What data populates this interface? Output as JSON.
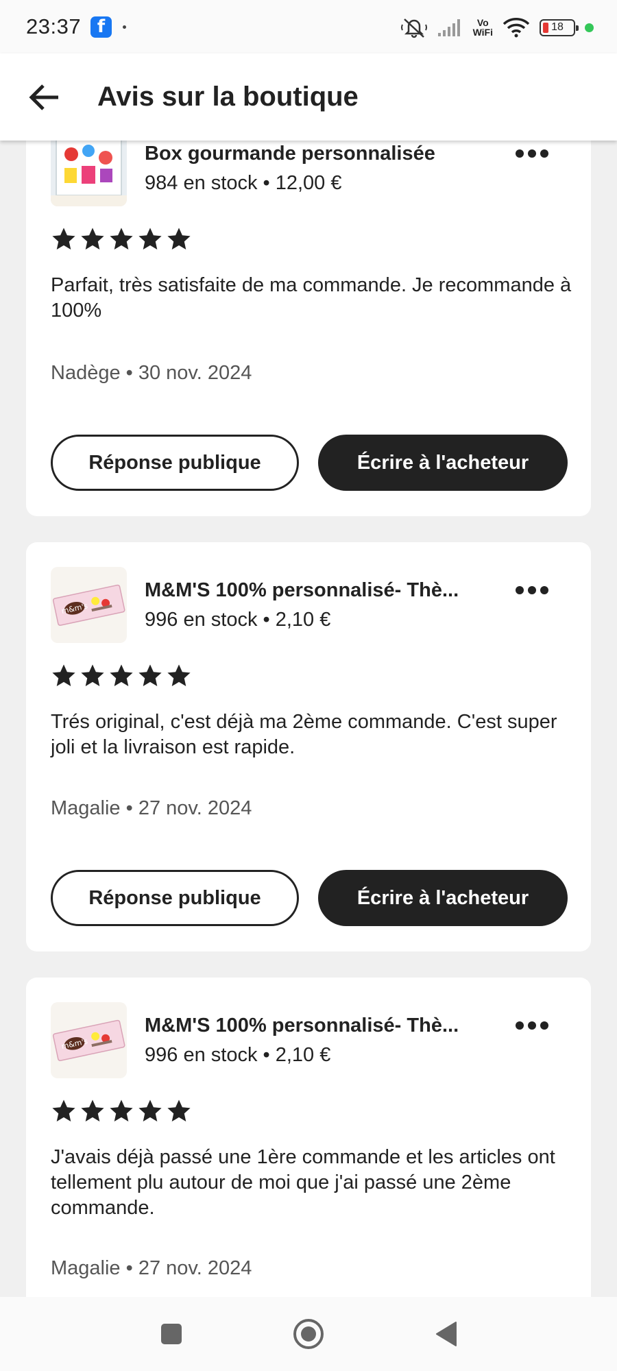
{
  "status_bar": {
    "time": "23:37",
    "battery_level": "18",
    "notification_icons": [
      "facebook-icon"
    ],
    "indicator_icons": [
      "mute-vibrate-icon",
      "signal-icon",
      "vowifi-icon",
      "wifi-icon",
      "battery-icon",
      "privacy-dot-icon"
    ],
    "vowifi_top": "Vo",
    "vowifi_bottom": "WiFi"
  },
  "header": {
    "back_icon": "arrow-left-icon",
    "title": "Avis sur la boutique"
  },
  "reviews": [
    {
      "product_title": "Box gourmande personnalisée",
      "product_meta": "984 en stock • 12,00 €",
      "rating": 5,
      "text": "Parfait, très satisfaite de ma commande. Je recommande à 100%",
      "reviewer": "Nadège • 30 nov. 2024",
      "public_reply_label": "Réponse publique",
      "message_buyer_label": "Écrire à l'acheteur",
      "thumbnail": "box-gift-image"
    },
    {
      "product_title": "M&M'S 100% personnalisé- Thè...",
      "product_meta": "996 en stock • 2,10 €",
      "rating": 5,
      "text": "Trés original, c'est déjà ma 2ème commande. C'est super joli et la livraison est rapide.",
      "reviewer": "Magalie • 27 nov. 2024",
      "public_reply_label": "Réponse publique",
      "message_buyer_label": "Écrire à l'acheteur",
      "thumbnail": "mms-pack-image"
    },
    {
      "product_title": "M&M'S 100% personnalisé- Thè...",
      "product_meta": "996 en stock • 2,10 €",
      "rating": 5,
      "text": "J'avais déjà passé une 1ère commande et les articles ont tellement plu autour de moi que j'ai passé une 2ème commande.",
      "reviewer": "Magalie • 27 nov. 2024",
      "thumbnail": "mms-pack-image"
    }
  ],
  "nav_bar": {
    "icons": [
      "recents-square-icon",
      "home-circle-icon",
      "back-triangle-icon"
    ]
  },
  "colors": {
    "background": "#f0f0f0",
    "card": "#ffffff",
    "text": "#222222",
    "secondary_text": "#555555",
    "dark_button": "#222222",
    "facebook_blue": "#1877f2",
    "battery_low": "#e53935",
    "privacy_dot": "#34c759"
  }
}
